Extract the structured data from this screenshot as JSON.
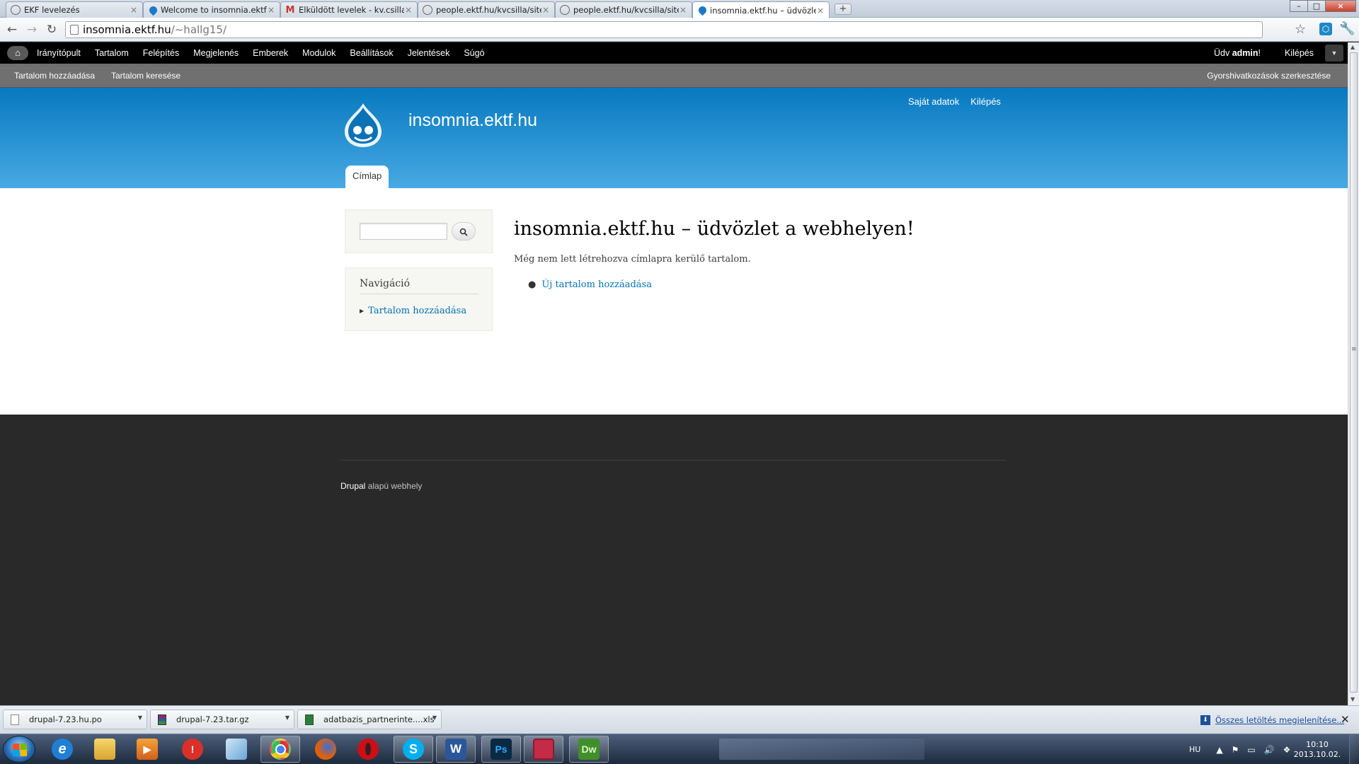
{
  "browser": {
    "tabs": [
      {
        "title": "EKF levelezés",
        "icon": "globe-icon"
      },
      {
        "title": "Welcome to insomnia.ektf.",
        "icon": "drupal-icon"
      },
      {
        "title": "Elküldött levelek - kv.csilla",
        "icon": "gmail-icon"
      },
      {
        "title": "people.ektf.hu/kvcsilla/site",
        "icon": "globe-icon"
      },
      {
        "title": "people.ektf.hu/kvcsilla/site",
        "icon": "globe-icon"
      },
      {
        "title": "insomnia.ektf.hu – üdvözle",
        "icon": "drupal-icon",
        "active": true
      }
    ],
    "url_host": "insomnia.ektf.hu",
    "url_path": "/~hallg15/"
  },
  "admin": {
    "menu": [
      "Irányítópult",
      "Tartalom",
      "Felépítés",
      "Megjelenés",
      "Emberek",
      "Modulok",
      "Beállítások",
      "Jelentések",
      "Súgó"
    ],
    "greeting_prefix": "Üdv ",
    "username": "admin",
    "greeting_suffix": "!",
    "logout": "Kilépés"
  },
  "shortcuts": {
    "items": [
      "Tartalom hozzáadása",
      "Tartalom keresése"
    ],
    "edit": "Gyorshivatkozások szerkesztése"
  },
  "site": {
    "name": "insomnia.ektf.hu",
    "secondary_menu": [
      "Saját adatok",
      "Kilépés"
    ],
    "main_tab": "Címlap"
  },
  "sidebar": {
    "nav_title": "Navigáció",
    "nav_link": "Tartalom hozzáadása"
  },
  "main": {
    "title": "insomnia.ektf.hu – üdvözlet a webhelyen!",
    "text": "Még nem lett létrehozva címlapra kerülő tartalom.",
    "link": "Új tartalom hozzáadása"
  },
  "footer": {
    "drupal": "Drupal",
    "credit": " alapú webhely"
  },
  "downloads": {
    "items": [
      "drupal-7.23.hu.po",
      "drupal-7.23.tar.gz",
      "adatbazis_partnerinte....xls"
    ],
    "show_all": "Összes letöltés megjelenítése..."
  },
  "taskbar": {
    "apps": [
      "internet-explorer",
      "windows-explorer",
      "media-player",
      "red-app",
      "notes",
      "chrome",
      "firefox",
      "opera",
      "skype",
      "word",
      "photoshop",
      "save-app",
      "dreamweaver"
    ],
    "lang": "HU",
    "time": "10:10",
    "date": "2013.10.02."
  },
  "colors": {
    "header_top": "#0779bf",
    "header_bottom": "#48a9e4",
    "link": "#0071b3",
    "footer_bg": "#292929"
  }
}
